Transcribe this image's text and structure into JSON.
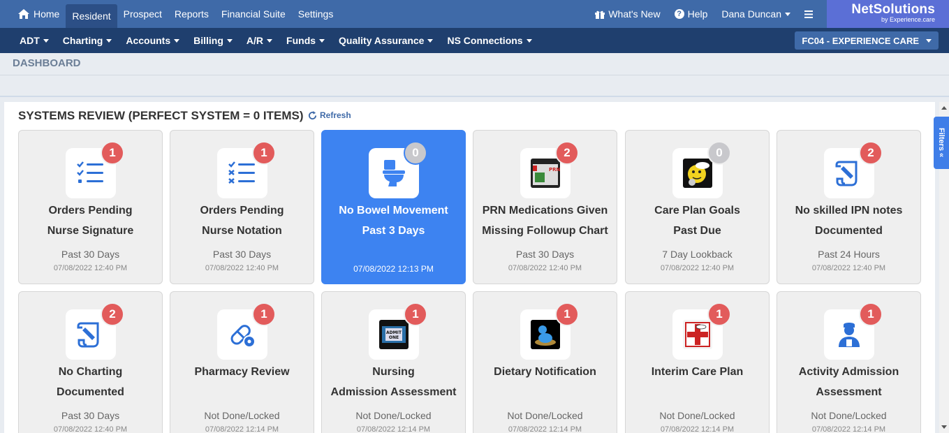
{
  "topnav": {
    "home": "Home",
    "resident": "Resident",
    "prospect": "Prospect",
    "reports": "Reports",
    "financial_suite": "Financial Suite",
    "settings": "Settings",
    "whats_new": "What's New",
    "help": "Help",
    "user": "Dana Duncan",
    "brand_name": "NetSolutions",
    "brand_by": "by Experience.care"
  },
  "subnav": {
    "items": [
      "ADT",
      "Charting",
      "Accounts",
      "Billing",
      "A/R",
      "Funds",
      "Quality Assurance",
      "NS Connections"
    ],
    "facility": "FC04 - EXPERIENCE CARE"
  },
  "page": {
    "title": "DASHBOARD",
    "section_title": "SYSTEMS REVIEW (PERFECT SYSTEM = 0 ITEMS)",
    "refresh": "Refresh",
    "filters": "Filters"
  },
  "colors": {
    "top_nav": "#3f6aa8",
    "sub_nav": "#1f3f6e",
    "accent": "#3d83f1",
    "badge_red": "#e25b5b",
    "badge_zero": "#c8c8cc"
  },
  "cards": [
    {
      "count": "1",
      "line1": "Orders Pending",
      "line2": "Nurse Signature",
      "sub": "Past 30 Days",
      "date": "07/08/2022 12:40 PM",
      "icon": "checklist-icon"
    },
    {
      "count": "1",
      "line1": "Orders Pending",
      "line2": "Nurse Notation",
      "sub": "Past 30 Days",
      "date": "07/08/2022 12:40 PM",
      "icon": "x-checklist-icon"
    },
    {
      "count": "0",
      "line1": "No Bowel Movement",
      "line2": "Past 3 Days",
      "sub": "",
      "date": "07/08/2022 12:13 PM",
      "icon": "toilet-icon"
    },
    {
      "count": "2",
      "line1": "PRN Medications Given",
      "line2": "Missing Followup Chart",
      "sub": "Past 30 Days",
      "date": "07/08/2022 12:40 PM",
      "icon": "prn-image"
    },
    {
      "count": "0",
      "line1": "Care Plan Goals",
      "line2": "Past Due",
      "sub": "7 Day Lookback",
      "date": "07/08/2022 12:40 PM",
      "icon": "smiley-clock-image"
    },
    {
      "count": "2",
      "line1": "No skilled IPN notes",
      "line2": "Documented",
      "sub": "Past 24 Hours",
      "date": "07/08/2022 12:40 PM",
      "icon": "scroll-pen-icon"
    },
    {
      "count": "2",
      "line1": "No Charting",
      "line2": "Documented",
      "sub": "Past 30 Days",
      "date": "07/08/2022 12:40 PM",
      "icon": "scroll-pen-icon"
    },
    {
      "count": "1",
      "line1": "Pharmacy Review",
      "line2": "",
      "sub": "Not Done/Locked",
      "date": "07/08/2022 12:14 PM",
      "icon": "pill-gear-icon"
    },
    {
      "count": "1",
      "line1": "Nursing",
      "line2": "Admission Assessment",
      "sub": "Not Done/Locked",
      "date": "07/08/2022 12:14 PM",
      "icon": "admit-ticket-image"
    },
    {
      "count": "1",
      "line1": "Dietary Notification",
      "line2": "",
      "sub": "Not Done/Locked",
      "date": "07/08/2022 12:14 PM",
      "icon": "person-globe-image"
    },
    {
      "count": "1",
      "line1": "Interim Care Plan",
      "line2": "",
      "sub": "Not Done/Locked",
      "date": "07/08/2022 12:14 PM",
      "icon": "nursing-care-plan-image"
    },
    {
      "count": "1",
      "line1": "Activity Admission",
      "line2": "Assessment",
      "sub": "Not Done/Locked",
      "date": "07/08/2022 12:14 PM",
      "icon": "nurse-person-icon"
    }
  ]
}
